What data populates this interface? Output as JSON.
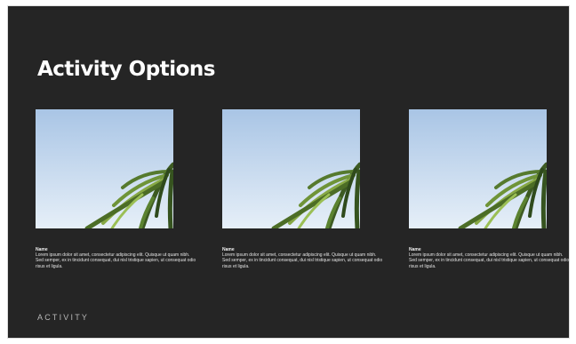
{
  "slide": {
    "title": "Activity Options",
    "footer": "ACTIVITY"
  },
  "cards": [
    {
      "image": "palm-tree-against-sky-image",
      "name": "Name",
      "description": "Lorem ipsum dolor sit amet, consectetur adipiscing elit. Quisque ut quam nibh. Sed semper, ex in tincidunt consequat, dui nisl tristique sapien, ut consequat odio risus et ligula."
    },
    {
      "image": "palm-tree-against-sky-image",
      "name": "Name",
      "description": "Lorem ipsum dolor sit amet, consectetur adipiscing elit. Quisque ut quam nibh. Sed semper, ex in tincidunt consequat, dui nisl tristique sapien, ut consequat odio risus et ligula."
    },
    {
      "image": "palm-tree-against-sky-image",
      "name": "Name",
      "description": "Lorem ipsum dolor sit amet, consectetur adipiscing elit. Quisque ut quam nibh. Sed semper, ex in tincidunt consequat, dui nisl tristique sapien, ut consequat odio risus et ligula."
    }
  ],
  "colors": {
    "background": "#252525",
    "sky_top": "#aac6e6",
    "sky_bottom": "#e4eef8",
    "palm_dark": "#2f4a1c",
    "palm_light": "#8db04a"
  }
}
